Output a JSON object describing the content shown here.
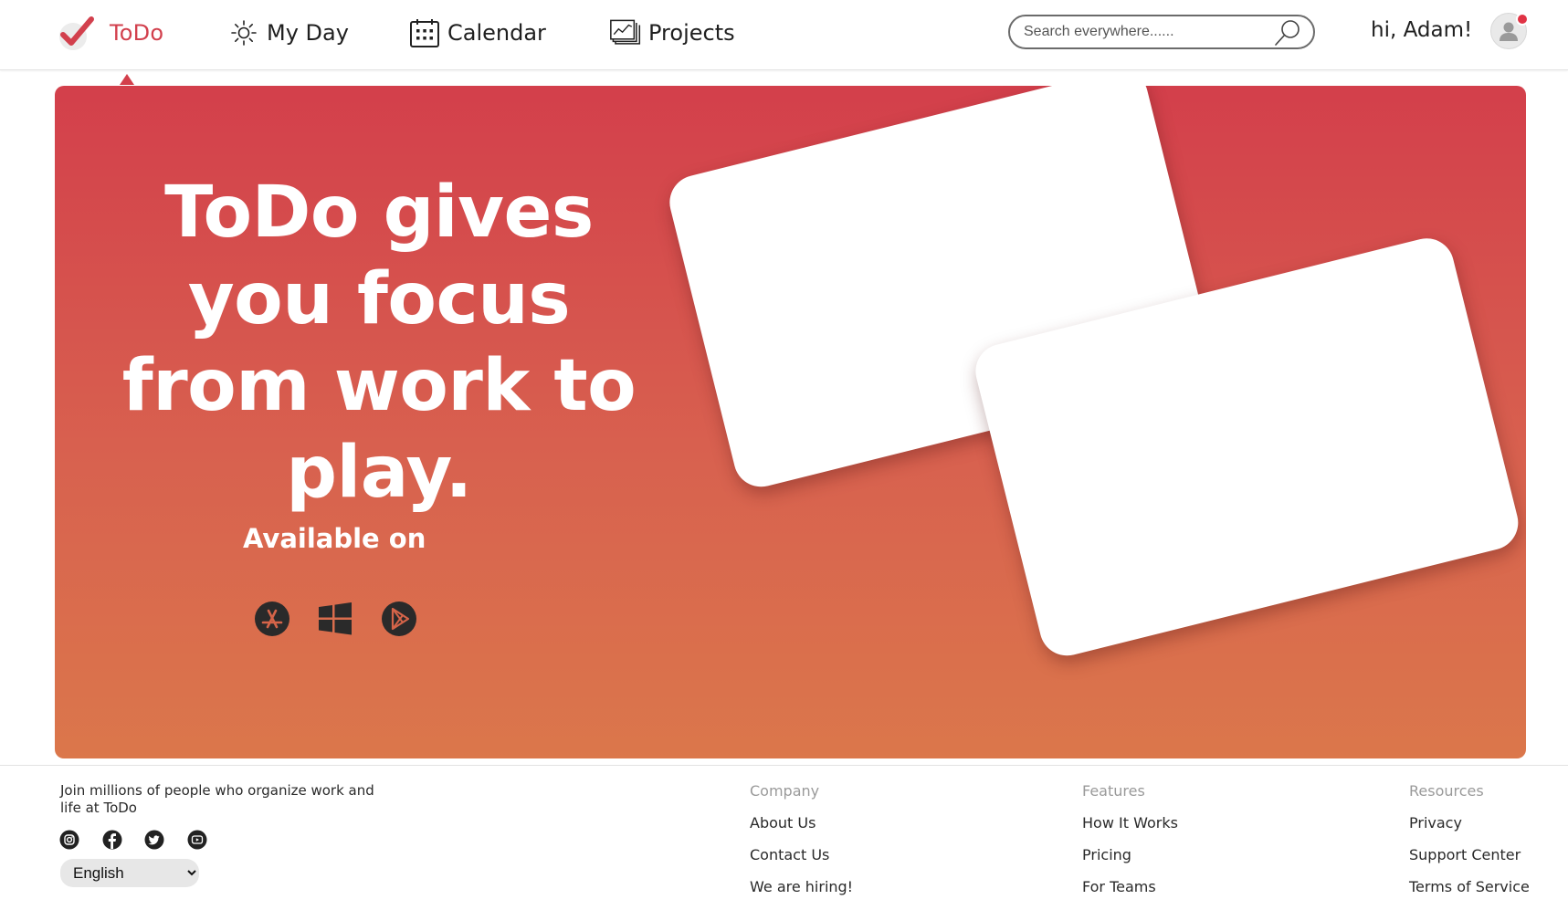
{
  "header": {
    "brand": "ToDo",
    "nav": [
      {
        "label": "My Day",
        "icon": "sun-icon"
      },
      {
        "label": "Calendar",
        "icon": "calendar-icon"
      },
      {
        "label": "Projects",
        "icon": "projects-chart-icon"
      }
    ],
    "search_placeholder": "Search everywhere......",
    "greeting": "hi, Adam!",
    "has_notification": true
  },
  "hero": {
    "headline": "ToDo gives you focus from work to play.",
    "available_on": "Available on",
    "stores": [
      {
        "icon": "app-store-icon"
      },
      {
        "icon": "windows-icon"
      },
      {
        "icon": "google-play-icon"
      }
    ]
  },
  "footer": {
    "tagline": "Join millions of people who organize work and life at ToDo",
    "social": [
      "instagram-icon",
      "facebook-icon",
      "twitter-icon",
      "youtube-icon"
    ],
    "language": "English",
    "columns": {
      "company": {
        "heading": "Company",
        "links": [
          "About Us",
          "Contact Us",
          "We are hiring!"
        ]
      },
      "features": {
        "heading": "Features",
        "links": [
          "How It Works",
          "Pricing",
          "For Teams"
        ]
      },
      "resources": {
        "heading": "Resources",
        "links": [
          "Privacy",
          "Support Center",
          "Terms of Service"
        ]
      }
    }
  },
  "colors": {
    "brand": "#d2404d",
    "hero_top": "#d33f4b",
    "hero_bottom": "#db774b",
    "notification": "#e03345"
  }
}
